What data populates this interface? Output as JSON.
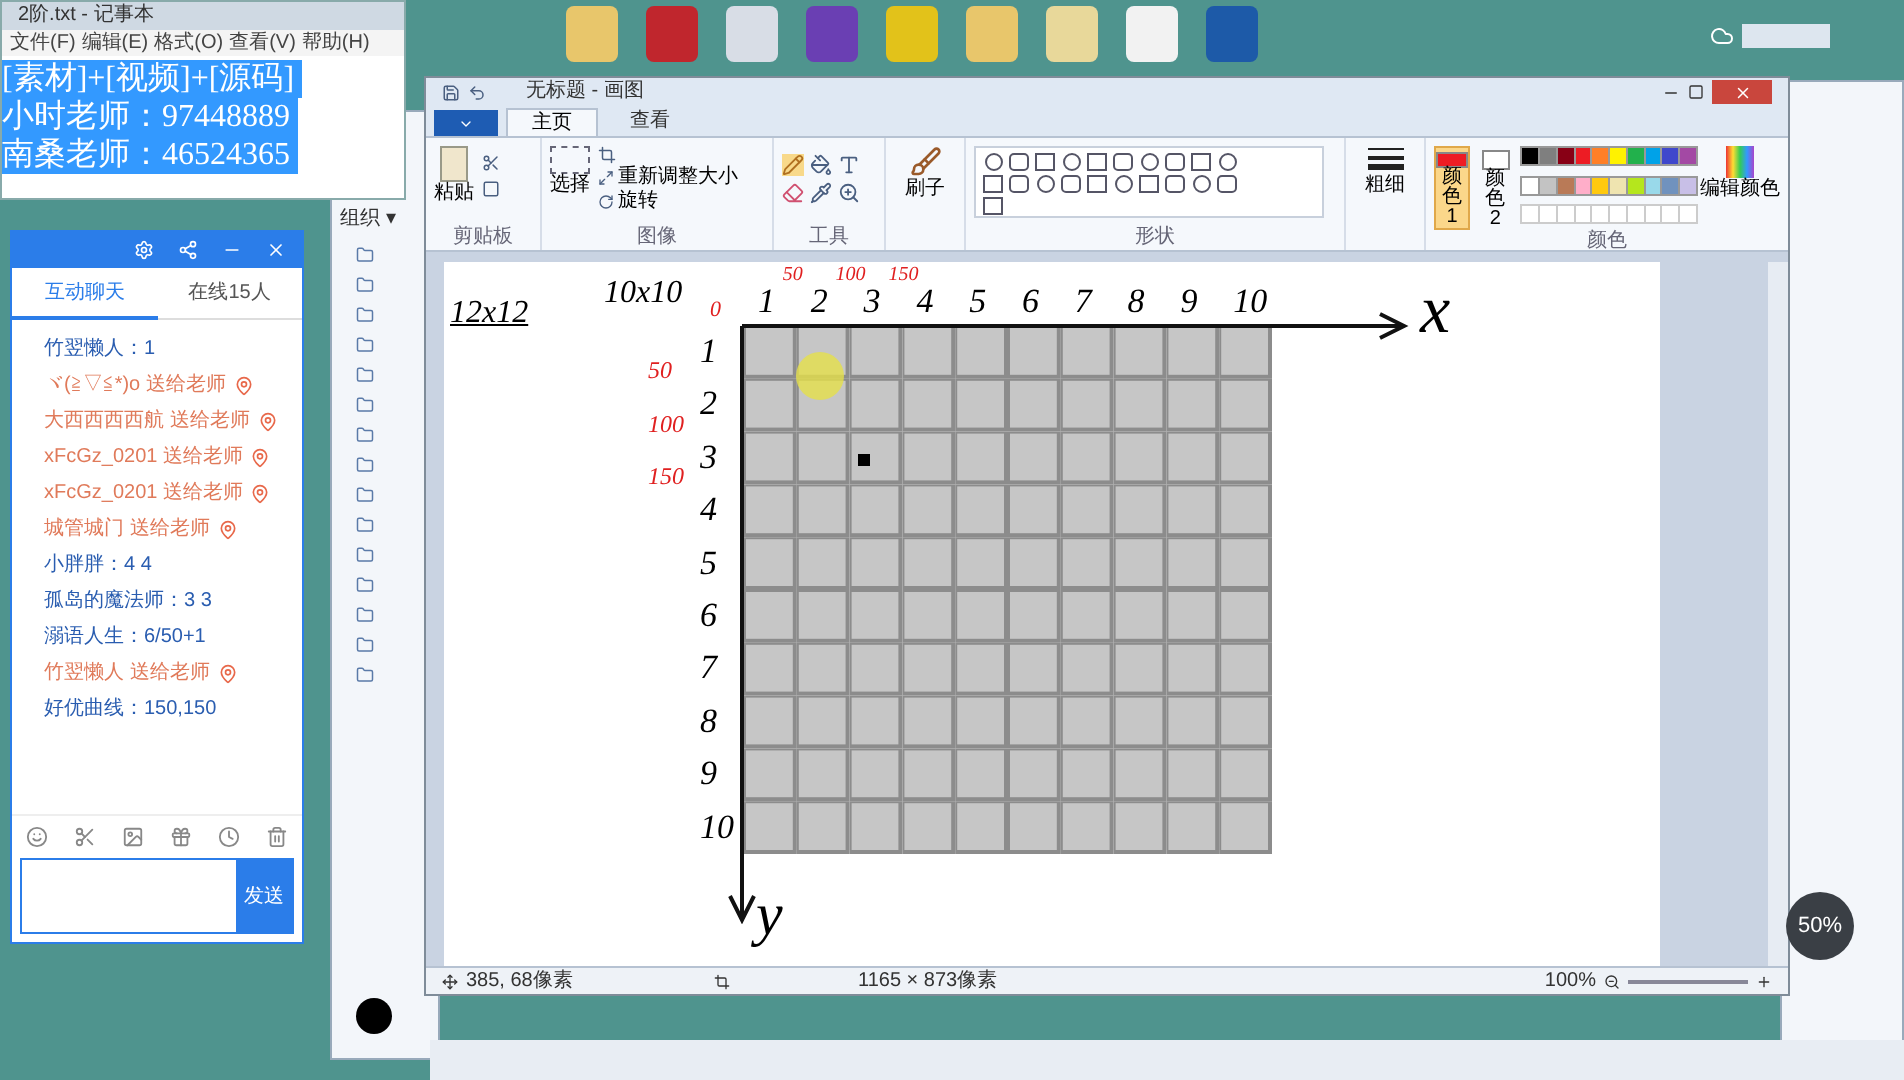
{
  "notepad": {
    "title": "2阶.txt - 记事本",
    "menu": [
      "文件(F)",
      "编辑(E)",
      "格式(O)",
      "查看(V)",
      "帮助(H)"
    ],
    "lines": [
      "[素材]+[视频]+[源码]",
      "小时老师：97448889",
      "南桑老师：46524365"
    ]
  },
  "explorer": {
    "toolbar": "组织 ▾"
  },
  "chat": {
    "tabs": [
      {
        "label": "互动聊天",
        "selected": true
      },
      {
        "label": "在线15人",
        "selected": false
      }
    ],
    "messages": [
      {
        "kind": "text",
        "text": "竹翌懒人：1"
      },
      {
        "kind": "gift",
        "text": "ヾ(≧▽≦*)o 送给老师"
      },
      {
        "kind": "gift",
        "text": "大西西西西航 送给老师"
      },
      {
        "kind": "gift",
        "text": "xFcGz_0201 送给老师"
      },
      {
        "kind": "gift",
        "text": "xFcGz_0201 送给老师"
      },
      {
        "kind": "gift",
        "text": "城管城门 送给老师"
      },
      {
        "kind": "text",
        "text": "小胖胖：4 4"
      },
      {
        "kind": "text",
        "text": "孤岛的魔法师：3 3"
      },
      {
        "kind": "text",
        "text": "溺语人生：6/50+1"
      },
      {
        "kind": "gift",
        "text": "竹翌懒人 送给老师"
      },
      {
        "kind": "text",
        "text": "好优曲线：150,150"
      }
    ],
    "send": "发送"
  },
  "paint": {
    "title": "无标题 - 画图",
    "tabs": [
      {
        "label": "主页",
        "selected": true
      },
      {
        "label": "查看",
        "selected": false
      }
    ],
    "clipboard": {
      "paste": "粘贴",
      "label": "剪贴板"
    },
    "image": {
      "select": "选择",
      "resize": "重新调整大小",
      "rotate": "旋转",
      "label": "图像"
    },
    "tools": {
      "label": "工具"
    },
    "brush": "刷子",
    "shapes": {
      "label": "形状"
    },
    "size": "粗细",
    "color1": {
      "label": "颜色 1",
      "color": "#ed1c24"
    },
    "color2": {
      "label": "颜色 2",
      "color": "#ffffff"
    },
    "palette": [
      {
        "color": "#000000"
      },
      {
        "color": "#7f7f7f"
      },
      {
        "color": "#880015"
      },
      {
        "color": "#ed1c24"
      },
      {
        "color": "#ff7f27"
      },
      {
        "color": "#fff200"
      },
      {
        "color": "#22b14c"
      },
      {
        "color": "#00a2e8"
      },
      {
        "color": "#3f48cc"
      },
      {
        "color": "#a349a4"
      },
      {
        "color": "#ffffff"
      },
      {
        "color": "#c3c3c3"
      },
      {
        "color": "#b97a57"
      },
      {
        "color": "#ffaec9"
      },
      {
        "color": "#ffc90e"
      },
      {
        "color": "#efe4b0"
      },
      {
        "color": "#b5e61d"
      },
      {
        "color": "#99d9ea"
      },
      {
        "color": "#7092be"
      },
      {
        "color": "#c8bfe7"
      }
    ],
    "edit_colors": "编辑颜色",
    "colors_label": "颜色",
    "canvas": {
      "notes": [
        "12x12",
        "10x10"
      ],
      "origin": "0",
      "x_ticks": [
        "1",
        "2",
        "3",
        "4",
        "5",
        "6",
        "7",
        "8",
        "9",
        "10"
      ],
      "x_marks": [
        "50",
        "100",
        "150"
      ],
      "y_ticks": [
        "1",
        "2",
        "3",
        "4",
        "5",
        "6",
        "7",
        "8",
        "9",
        "10"
      ],
      "y_marks": [
        "50",
        "100",
        "150"
      ],
      "x_axis": "x",
      "y_axis": "y"
    },
    "status": {
      "cursor": "385, 68像素",
      "size": "1165 × 873像素",
      "zoom": "100%"
    }
  },
  "zoom_badge": "50%"
}
